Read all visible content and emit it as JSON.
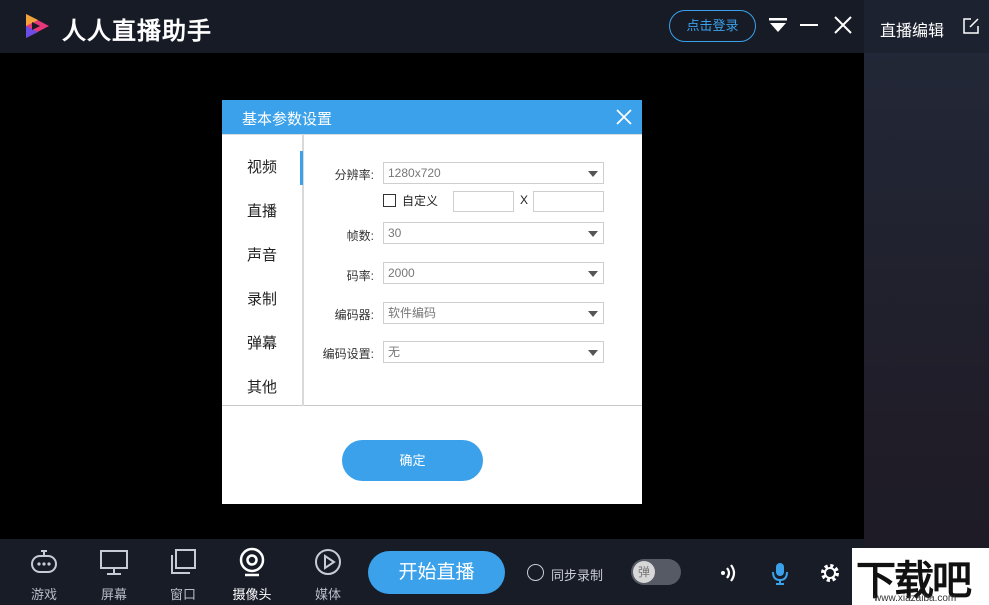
{
  "app": {
    "title": "人人直播助手",
    "login_label": "点击登录"
  },
  "right_panel": {
    "title": "直播编辑"
  },
  "dialog": {
    "title": "基本参数设置",
    "side_items": [
      "视频",
      "直播",
      "声音",
      "录制",
      "弹幕",
      "其他"
    ],
    "active_side_item": "视频",
    "fields": {
      "resolution": {
        "label": "分辨率:",
        "value": "1280x720"
      },
      "custom": {
        "label": "自定义",
        "checked": false,
        "separator": "X"
      },
      "fps": {
        "label": "帧数:",
        "value": "30"
      },
      "bitrate": {
        "label": "码率:",
        "value": "2000"
      },
      "encoder": {
        "label": "编码器:",
        "value": "软件编码"
      },
      "encoder_settings": {
        "label": "编码设置:",
        "value": "无"
      }
    },
    "confirm_label": "确定"
  },
  "toolbar": {
    "tools": [
      {
        "label": "游戏",
        "icon": "gamepad-icon"
      },
      {
        "label": "屏幕",
        "icon": "monitor-icon"
      },
      {
        "label": "窗口",
        "icon": "window-icon"
      },
      {
        "label": "摄像头",
        "icon": "camera-icon"
      },
      {
        "label": "媒体",
        "icon": "play-icon"
      }
    ],
    "active_tool": "摄像头",
    "start_label": "开始直播",
    "sync_record_label": "同步录制",
    "danmaku_toggle_label": "弹"
  },
  "watermark": {
    "text": "下载吧",
    "url": "www.xiazaiba.com"
  },
  "colors": {
    "accent": "#3aa1ea",
    "titlebar": "#171b26",
    "toolbar": "#181c27"
  }
}
